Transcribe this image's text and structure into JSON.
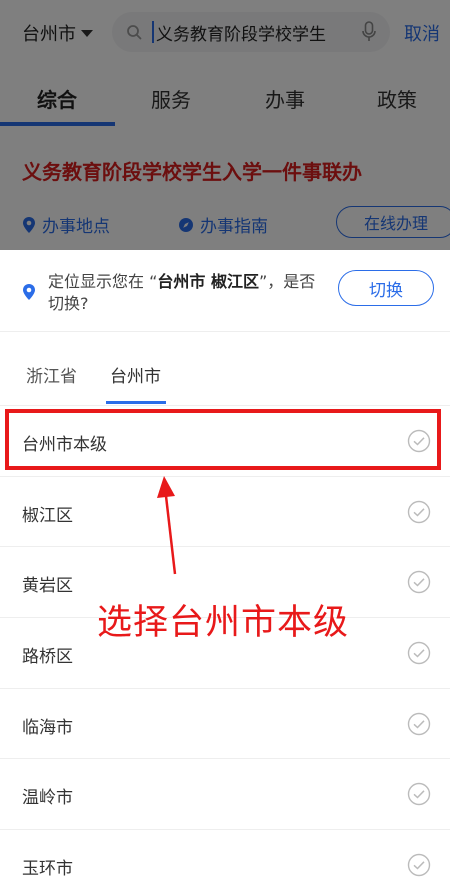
{
  "header": {
    "city": "台州市",
    "search_value": "义务教育阶段学校学生",
    "cancel_label": "取消"
  },
  "tabs": [
    "综合",
    "服务",
    "办事",
    "政策"
  ],
  "result": {
    "title": "义务教育阶段学校学生入学一件事联办",
    "location_label": "办事地点",
    "guide_label": "办事指南",
    "online_label": "在线办理"
  },
  "locate": {
    "prefix": "定位显示您在 “",
    "place": "台州市 椒江区",
    "suffix": "”，是否切换?",
    "switch_label": "切换"
  },
  "region_tabs": [
    "浙江省",
    "台州市"
  ],
  "list": [
    "台州市本级",
    "椒江区",
    "黄岩区",
    "路桥区",
    "临海市",
    "温岭市",
    "玉环市"
  ],
  "annotation": {
    "text": "选择台州市本级"
  },
  "colors": {
    "accent": "#2b6de8",
    "highlight": "#e8191a",
    "result_title": "#d81e1e"
  }
}
